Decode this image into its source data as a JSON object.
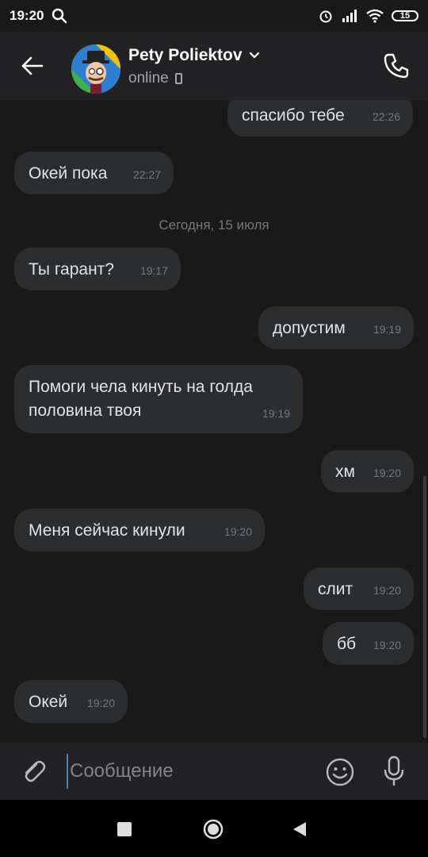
{
  "status_bar": {
    "time": "19:20",
    "battery": "15"
  },
  "header": {
    "contact_name": "Pety Poliektov",
    "status": "online",
    "icons": [
      "back-arrow-icon",
      "avatar",
      "chevron-down-icon",
      "phone-device-icon",
      "phone-call-icon"
    ]
  },
  "messages": [
    {
      "text": "спасибо тебе",
      "time": "22:26",
      "side": "out"
    },
    {
      "text": "Окей пока",
      "time": "22:27",
      "side": "in"
    },
    {
      "separator": "Сегодня, 15 июля"
    },
    {
      "text": "Ты гарант?",
      "time": "19:17",
      "side": "in"
    },
    {
      "text": "допустим",
      "time": "19:19",
      "side": "out"
    },
    {
      "text_line1": "Помоги чела кинуть на голда",
      "text_line2": "половина твоя",
      "time": "19:19",
      "side": "in"
    },
    {
      "text": "хм",
      "time": "19:20",
      "side": "out"
    },
    {
      "text": "Меня сейчас кинули",
      "time": "19:20",
      "side": "in"
    },
    {
      "text": "слит",
      "time": "19:20",
      "side": "out"
    },
    {
      "text": "бб",
      "time": "19:20",
      "side": "out"
    },
    {
      "text": "Окей",
      "time": "19:20",
      "side": "in"
    }
  ],
  "composer": {
    "placeholder": "Сообщение"
  },
  "colors": {
    "background": "#19191a",
    "bubble": "#2c2d2f",
    "accent": "#5181b8",
    "header": "#222224"
  }
}
